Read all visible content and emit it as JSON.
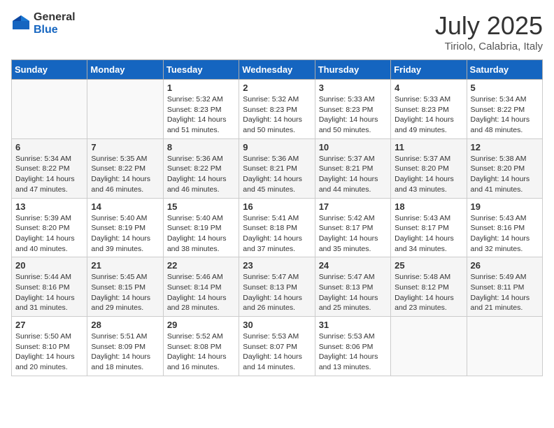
{
  "header": {
    "logo_general": "General",
    "logo_blue": "Blue",
    "month_title": "July 2025",
    "location": "Tiriolo, Calabria, Italy"
  },
  "days_of_week": [
    "Sunday",
    "Monday",
    "Tuesday",
    "Wednesday",
    "Thursday",
    "Friday",
    "Saturday"
  ],
  "weeks": [
    [
      {
        "day": "",
        "sunrise": "",
        "sunset": "",
        "daylight": ""
      },
      {
        "day": "",
        "sunrise": "",
        "sunset": "",
        "daylight": ""
      },
      {
        "day": "1",
        "sunrise": "Sunrise: 5:32 AM",
        "sunset": "Sunset: 8:23 PM",
        "daylight": "Daylight: 14 hours and 51 minutes."
      },
      {
        "day": "2",
        "sunrise": "Sunrise: 5:32 AM",
        "sunset": "Sunset: 8:23 PM",
        "daylight": "Daylight: 14 hours and 50 minutes."
      },
      {
        "day": "3",
        "sunrise": "Sunrise: 5:33 AM",
        "sunset": "Sunset: 8:23 PM",
        "daylight": "Daylight: 14 hours and 50 minutes."
      },
      {
        "day": "4",
        "sunrise": "Sunrise: 5:33 AM",
        "sunset": "Sunset: 8:23 PM",
        "daylight": "Daylight: 14 hours and 49 minutes."
      },
      {
        "day": "5",
        "sunrise": "Sunrise: 5:34 AM",
        "sunset": "Sunset: 8:22 PM",
        "daylight": "Daylight: 14 hours and 48 minutes."
      }
    ],
    [
      {
        "day": "6",
        "sunrise": "Sunrise: 5:34 AM",
        "sunset": "Sunset: 8:22 PM",
        "daylight": "Daylight: 14 hours and 47 minutes."
      },
      {
        "day": "7",
        "sunrise": "Sunrise: 5:35 AM",
        "sunset": "Sunset: 8:22 PM",
        "daylight": "Daylight: 14 hours and 46 minutes."
      },
      {
        "day": "8",
        "sunrise": "Sunrise: 5:36 AM",
        "sunset": "Sunset: 8:22 PM",
        "daylight": "Daylight: 14 hours and 46 minutes."
      },
      {
        "day": "9",
        "sunrise": "Sunrise: 5:36 AM",
        "sunset": "Sunset: 8:21 PM",
        "daylight": "Daylight: 14 hours and 45 minutes."
      },
      {
        "day": "10",
        "sunrise": "Sunrise: 5:37 AM",
        "sunset": "Sunset: 8:21 PM",
        "daylight": "Daylight: 14 hours and 44 minutes."
      },
      {
        "day": "11",
        "sunrise": "Sunrise: 5:37 AM",
        "sunset": "Sunset: 8:20 PM",
        "daylight": "Daylight: 14 hours and 43 minutes."
      },
      {
        "day": "12",
        "sunrise": "Sunrise: 5:38 AM",
        "sunset": "Sunset: 8:20 PM",
        "daylight": "Daylight: 14 hours and 41 minutes."
      }
    ],
    [
      {
        "day": "13",
        "sunrise": "Sunrise: 5:39 AM",
        "sunset": "Sunset: 8:20 PM",
        "daylight": "Daylight: 14 hours and 40 minutes."
      },
      {
        "day": "14",
        "sunrise": "Sunrise: 5:40 AM",
        "sunset": "Sunset: 8:19 PM",
        "daylight": "Daylight: 14 hours and 39 minutes."
      },
      {
        "day": "15",
        "sunrise": "Sunrise: 5:40 AM",
        "sunset": "Sunset: 8:19 PM",
        "daylight": "Daylight: 14 hours and 38 minutes."
      },
      {
        "day": "16",
        "sunrise": "Sunrise: 5:41 AM",
        "sunset": "Sunset: 8:18 PM",
        "daylight": "Daylight: 14 hours and 37 minutes."
      },
      {
        "day": "17",
        "sunrise": "Sunrise: 5:42 AM",
        "sunset": "Sunset: 8:17 PM",
        "daylight": "Daylight: 14 hours and 35 minutes."
      },
      {
        "day": "18",
        "sunrise": "Sunrise: 5:43 AM",
        "sunset": "Sunset: 8:17 PM",
        "daylight": "Daylight: 14 hours and 34 minutes."
      },
      {
        "day": "19",
        "sunrise": "Sunrise: 5:43 AM",
        "sunset": "Sunset: 8:16 PM",
        "daylight": "Daylight: 14 hours and 32 minutes."
      }
    ],
    [
      {
        "day": "20",
        "sunrise": "Sunrise: 5:44 AM",
        "sunset": "Sunset: 8:16 PM",
        "daylight": "Daylight: 14 hours and 31 minutes."
      },
      {
        "day": "21",
        "sunrise": "Sunrise: 5:45 AM",
        "sunset": "Sunset: 8:15 PM",
        "daylight": "Daylight: 14 hours and 29 minutes."
      },
      {
        "day": "22",
        "sunrise": "Sunrise: 5:46 AM",
        "sunset": "Sunset: 8:14 PM",
        "daylight": "Daylight: 14 hours and 28 minutes."
      },
      {
        "day": "23",
        "sunrise": "Sunrise: 5:47 AM",
        "sunset": "Sunset: 8:13 PM",
        "daylight": "Daylight: 14 hours and 26 minutes."
      },
      {
        "day": "24",
        "sunrise": "Sunrise: 5:47 AM",
        "sunset": "Sunset: 8:13 PM",
        "daylight": "Daylight: 14 hours and 25 minutes."
      },
      {
        "day": "25",
        "sunrise": "Sunrise: 5:48 AM",
        "sunset": "Sunset: 8:12 PM",
        "daylight": "Daylight: 14 hours and 23 minutes."
      },
      {
        "day": "26",
        "sunrise": "Sunrise: 5:49 AM",
        "sunset": "Sunset: 8:11 PM",
        "daylight": "Daylight: 14 hours and 21 minutes."
      }
    ],
    [
      {
        "day": "27",
        "sunrise": "Sunrise: 5:50 AM",
        "sunset": "Sunset: 8:10 PM",
        "daylight": "Daylight: 14 hours and 20 minutes."
      },
      {
        "day": "28",
        "sunrise": "Sunrise: 5:51 AM",
        "sunset": "Sunset: 8:09 PM",
        "daylight": "Daylight: 14 hours and 18 minutes."
      },
      {
        "day": "29",
        "sunrise": "Sunrise: 5:52 AM",
        "sunset": "Sunset: 8:08 PM",
        "daylight": "Daylight: 14 hours and 16 minutes."
      },
      {
        "day": "30",
        "sunrise": "Sunrise: 5:53 AM",
        "sunset": "Sunset: 8:07 PM",
        "daylight": "Daylight: 14 hours and 14 minutes."
      },
      {
        "day": "31",
        "sunrise": "Sunrise: 5:53 AM",
        "sunset": "Sunset: 8:06 PM",
        "daylight": "Daylight: 14 hours and 13 minutes."
      },
      {
        "day": "",
        "sunrise": "",
        "sunset": "",
        "daylight": ""
      },
      {
        "day": "",
        "sunrise": "",
        "sunset": "",
        "daylight": ""
      }
    ]
  ]
}
